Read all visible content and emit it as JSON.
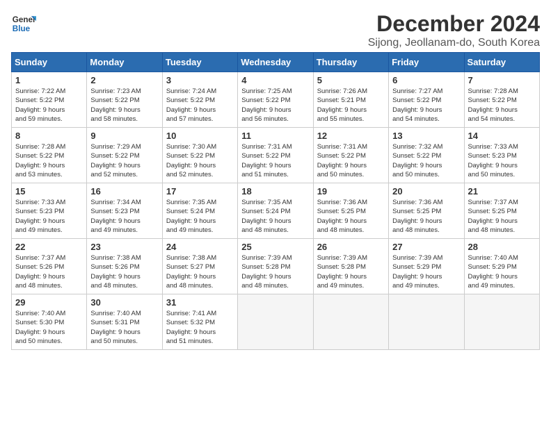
{
  "header": {
    "logo_line1": "General",
    "logo_line2": "Blue",
    "title": "December 2024",
    "subtitle": "Sijong, Jeollanam-do, South Korea"
  },
  "days_of_week": [
    "Sunday",
    "Monday",
    "Tuesday",
    "Wednesday",
    "Thursday",
    "Friday",
    "Saturday"
  ],
  "weeks": [
    [
      {
        "day": 1,
        "info": "Sunrise: 7:22 AM\nSunset: 5:22 PM\nDaylight: 9 hours\nand 59 minutes."
      },
      {
        "day": 2,
        "info": "Sunrise: 7:23 AM\nSunset: 5:22 PM\nDaylight: 9 hours\nand 58 minutes."
      },
      {
        "day": 3,
        "info": "Sunrise: 7:24 AM\nSunset: 5:22 PM\nDaylight: 9 hours\nand 57 minutes."
      },
      {
        "day": 4,
        "info": "Sunrise: 7:25 AM\nSunset: 5:22 PM\nDaylight: 9 hours\nand 56 minutes."
      },
      {
        "day": 5,
        "info": "Sunrise: 7:26 AM\nSunset: 5:21 PM\nDaylight: 9 hours\nand 55 minutes."
      },
      {
        "day": 6,
        "info": "Sunrise: 7:27 AM\nSunset: 5:22 PM\nDaylight: 9 hours\nand 54 minutes."
      },
      {
        "day": 7,
        "info": "Sunrise: 7:28 AM\nSunset: 5:22 PM\nDaylight: 9 hours\nand 54 minutes."
      }
    ],
    [
      {
        "day": 8,
        "info": "Sunrise: 7:28 AM\nSunset: 5:22 PM\nDaylight: 9 hours\nand 53 minutes."
      },
      {
        "day": 9,
        "info": "Sunrise: 7:29 AM\nSunset: 5:22 PM\nDaylight: 9 hours\nand 52 minutes."
      },
      {
        "day": 10,
        "info": "Sunrise: 7:30 AM\nSunset: 5:22 PM\nDaylight: 9 hours\nand 52 minutes."
      },
      {
        "day": 11,
        "info": "Sunrise: 7:31 AM\nSunset: 5:22 PM\nDaylight: 9 hours\nand 51 minutes."
      },
      {
        "day": 12,
        "info": "Sunrise: 7:31 AM\nSunset: 5:22 PM\nDaylight: 9 hours\nand 50 minutes."
      },
      {
        "day": 13,
        "info": "Sunrise: 7:32 AM\nSunset: 5:22 PM\nDaylight: 9 hours\nand 50 minutes."
      },
      {
        "day": 14,
        "info": "Sunrise: 7:33 AM\nSunset: 5:23 PM\nDaylight: 9 hours\nand 50 minutes."
      }
    ],
    [
      {
        "day": 15,
        "info": "Sunrise: 7:33 AM\nSunset: 5:23 PM\nDaylight: 9 hours\nand 49 minutes."
      },
      {
        "day": 16,
        "info": "Sunrise: 7:34 AM\nSunset: 5:23 PM\nDaylight: 9 hours\nand 49 minutes."
      },
      {
        "day": 17,
        "info": "Sunrise: 7:35 AM\nSunset: 5:24 PM\nDaylight: 9 hours\nand 49 minutes."
      },
      {
        "day": 18,
        "info": "Sunrise: 7:35 AM\nSunset: 5:24 PM\nDaylight: 9 hours\nand 48 minutes."
      },
      {
        "day": 19,
        "info": "Sunrise: 7:36 AM\nSunset: 5:25 PM\nDaylight: 9 hours\nand 48 minutes."
      },
      {
        "day": 20,
        "info": "Sunrise: 7:36 AM\nSunset: 5:25 PM\nDaylight: 9 hours\nand 48 minutes."
      },
      {
        "day": 21,
        "info": "Sunrise: 7:37 AM\nSunset: 5:25 PM\nDaylight: 9 hours\nand 48 minutes."
      }
    ],
    [
      {
        "day": 22,
        "info": "Sunrise: 7:37 AM\nSunset: 5:26 PM\nDaylight: 9 hours\nand 48 minutes."
      },
      {
        "day": 23,
        "info": "Sunrise: 7:38 AM\nSunset: 5:26 PM\nDaylight: 9 hours\nand 48 minutes."
      },
      {
        "day": 24,
        "info": "Sunrise: 7:38 AM\nSunset: 5:27 PM\nDaylight: 9 hours\nand 48 minutes."
      },
      {
        "day": 25,
        "info": "Sunrise: 7:39 AM\nSunset: 5:28 PM\nDaylight: 9 hours\nand 48 minutes."
      },
      {
        "day": 26,
        "info": "Sunrise: 7:39 AM\nSunset: 5:28 PM\nDaylight: 9 hours\nand 49 minutes."
      },
      {
        "day": 27,
        "info": "Sunrise: 7:39 AM\nSunset: 5:29 PM\nDaylight: 9 hours\nand 49 minutes."
      },
      {
        "day": 28,
        "info": "Sunrise: 7:40 AM\nSunset: 5:29 PM\nDaylight: 9 hours\nand 49 minutes."
      }
    ],
    [
      {
        "day": 29,
        "info": "Sunrise: 7:40 AM\nSunset: 5:30 PM\nDaylight: 9 hours\nand 50 minutes."
      },
      {
        "day": 30,
        "info": "Sunrise: 7:40 AM\nSunset: 5:31 PM\nDaylight: 9 hours\nand 50 minutes."
      },
      {
        "day": 31,
        "info": "Sunrise: 7:41 AM\nSunset: 5:32 PM\nDaylight: 9 hours\nand 51 minutes."
      },
      null,
      null,
      null,
      null
    ]
  ]
}
